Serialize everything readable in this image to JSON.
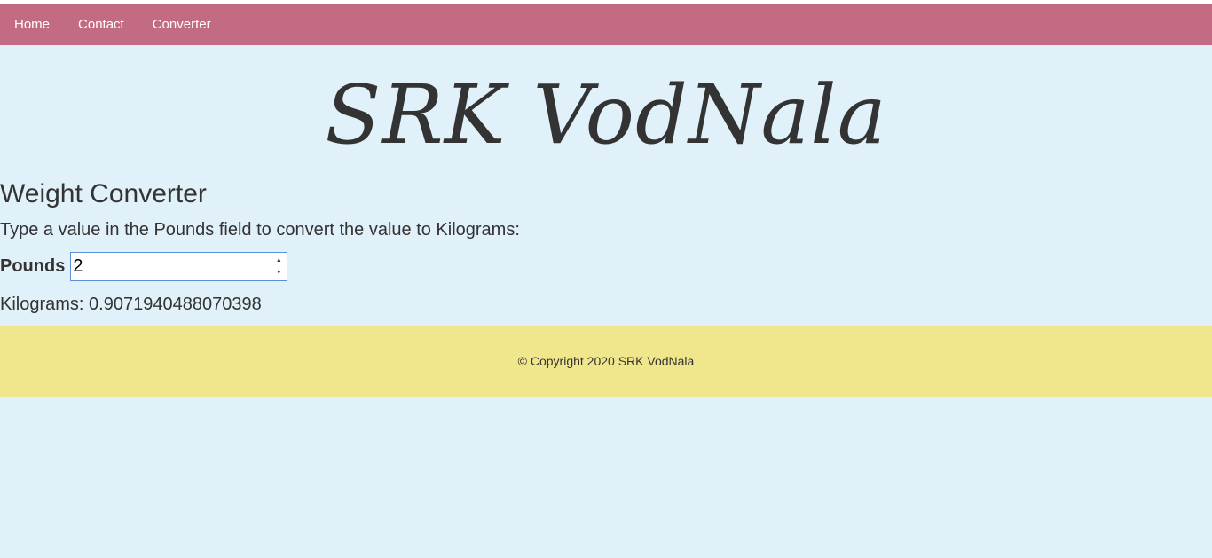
{
  "nav": {
    "items": [
      {
        "label": "Home"
      },
      {
        "label": "Contact"
      },
      {
        "label": "Converter"
      }
    ]
  },
  "header": {
    "brand": "SRK VodNala"
  },
  "main": {
    "title": "Weight Converter",
    "instructions": "Type a value in the Pounds field to convert the value to Kilograms:",
    "pounds_label": "Pounds",
    "pounds_value": "2",
    "result_label": "Kilograms:",
    "result_value": "0.9071940488070398"
  },
  "footer": {
    "copyright": "© Copyright 2020 SRK VodNala"
  },
  "colors": {
    "navbar": "#c36b82",
    "page_background": "#e1f1fa",
    "footer": "#f0e68c",
    "input_focus_border": "#5b8fd9"
  },
  "icons": {
    "spinner_up": "spinner-up-icon",
    "spinner_down": "spinner-down-icon"
  }
}
